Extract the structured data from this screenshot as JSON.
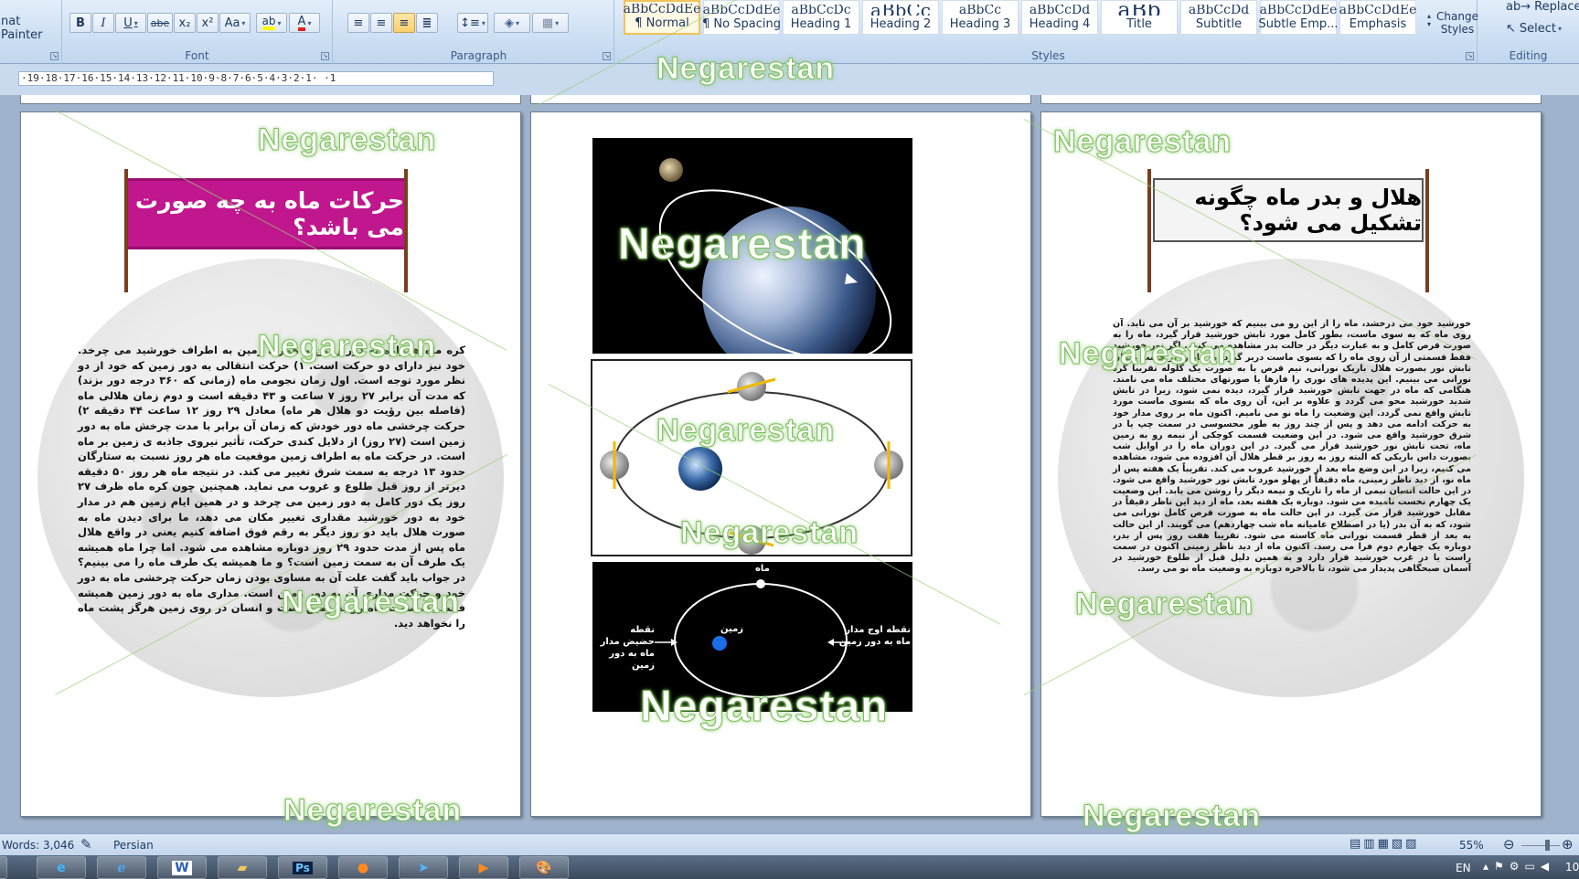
{
  "ribbon": {
    "clipboard": {
      "format_painter": "nat Painter"
    },
    "font": {
      "label": "Font",
      "buttons": [
        "B",
        "I",
        "U",
        "abe",
        "x₂",
        "x²",
        "Aa",
        "A"
      ]
    },
    "paragraph": {
      "label": "Paragraph"
    },
    "styles": {
      "label": "Styles",
      "items": [
        {
          "preview": "aBbCcDdEe",
          "name": "¶ Normal"
        },
        {
          "preview": "aBbCcDdEe",
          "name": "¶ No Spacing"
        },
        {
          "preview": "aBbCcDc",
          "name": "Heading 1"
        },
        {
          "preview": "aBbCc",
          "name": "Heading 2"
        },
        {
          "preview": "aBbCc",
          "name": "Heading 3"
        },
        {
          "preview": "aBbCcDd",
          "name": "Heading 4"
        },
        {
          "preview": "aBb",
          "name": "Title"
        },
        {
          "preview": "aBbCcDd",
          "name": "Subtitle"
        },
        {
          "preview": "aBbCcDdEe",
          "name": "Subtle Emp..."
        },
        {
          "preview": "aBbCcDdEe",
          "name": "Emphasis"
        }
      ],
      "change_styles": "Change Styles"
    },
    "editing": {
      "label": "Editing",
      "replace": "Replace",
      "select": "Select"
    }
  },
  "ruler": {
    "text": "·19·18·17·16·15·14·13·12·11·10·9·8·7·6·5·4·3·2·1· ·1"
  },
  "pages": {
    "left": {
      "banner_title": "حرکات ماه به چه صورت می باشد؟",
      "text": "کره ماه همواره به دور زمین و همراه زمین به اطراف خورشید می چرخد. خود نیز دارای دو حرکت است. ۱) حرکت انتقالی به دور زمین که خود از دو نظر مورد توجه است. اول زمان نجومی ماه (زمانی که ۳۶۰ درجه دور بزند) که مدت آن برابر ۲۷ روز ۷ ساعت و ۴۳ دقیقه است و دوم زمان هلالی ماه (فاصله بین رؤیت دو هلال هر ماه) معادل ۲۹ روز ۱۲ ساعت ۴۴ دقیقه ۲) حرکت چرخشی ماه دور خودش که زمان آن برابر با مدت چرخش ماه به دور زمین است (۲۷ روز) از دلایل کندی حرکت، تأثیر نیروی جاذبه ی زمین بر ماه است. در حرکت ماه به اطراف زمین موقعیت ماه هر روز نسبت به ستارگان حدود ۱۳ درجه به سمت شرق تغییر می کند. در نتیجه ماه هر روز ۵۰ دقیقه دیرتر از روز قبل طلوع و غروب می نماید. همچنین چون کره ماه ظرف ۲۷ روز یک دور کامل به دور زمین می چرخد و در همین ایام زمین هم در مدار خود به دور خورشید مقداری تغییر مکان می دهد، ما برای دیدن ماه به صورت هلال باید دو روز دیگر به رقم فوق اضافه کنیم یعنی در واقع هلال ماه پس از مدت حدود ۲۹ روز دوباره مشاهده می شود. اما چرا ماه همیشه یک طرف آن به سمت زمین است؟ و ما همیشه یک طرف ماه را می بینیم؟ در جواب باید گفت علت آن به مساوی بودن زمان حرکت چرخشی ماه به دور خود و حرکت مداری آن به دور زمین است. مداری ماه به دور زمین همیشه فقط یک سمت ماه رو به زمین است و انسان در روی زمین هرگز پشت ماه را نخواهد دید."
    },
    "middle": {
      "diagram3": {
        "moon_label": "ماه",
        "earth_label": "زمین",
        "perigee_label": "نقطه حضیض مدار ماه به دور زمین",
        "apogee_label": "نقطه اوج مدار ماه به دور زمین"
      }
    },
    "right": {
      "banner_title": "هلال و بدر ماه چگونه تشکیل می شود؟",
      "text": "خورشید خود می درخشد، ماه را از این رو می بینیم که خورشید بر آن می تابد. آن روی ماه که به سوی ماست، بطور کامل مورد تابش خورشید قرار گیرد، ماه را به صورت قرص کامل و به عبارت دیگر در حالت بدر مشاهده می کنیم. اگر نور خورشید فقط قسمتی از آن روی ماه را که بسوی ماست دربر گیرد، ما ماه را بر حسب میزان تابش نور بصورت هلال باریک نورانی، نیم قرص یا به صورت یک گلوله تقریبا گرد نورانی می بینیم. این پدیده های نوری را فازها یا صورتهای مختلف ماه می نامند. هنگامی که ماه در جهت تابش خورشید قرار گیرد، دیده نمی شود، زیرا در تابش شدید خورشید محو می گردد و علاوه بر این، آن روی ماه که بسوی ماست مورد تابش واقع نمی گردد. این وضعیت را ماه نو می نامیم. اکنون ماه بر روی مدار خود به حرکت ادامه می دهد و پس از چند روز به طور محسوسی در سمت چپ یا در شرق خورشید واقع می شود. در این وضعیت قسمت کوچکی از نیمه رو به زمین ماه، تحت تابش نور خورشید قرار می گیرد. در این دوران ماه را در اوایل شب بصورت داس باریکی که البته روز به روز بر قطر هلال آن افزوده می شود، مشاهده می کنیم، زیرا در این وضع ماه بعد از خورشید غروب می کند. تقریباً یک هفته پس از ماه نو، از دید ناظر زمینی، ماه دقیقاً از پهلو مورد تابش نور خورشید واقع می شود. در این حالت انسان نیمی از ماه را تاریک و نیمه دیگر را روشن می یابد. این وضعیت یک چهارم نخست نامیده می شود. دوباره یک هفته بعد، ماه از دید این ناظر دقیقاً در مقابل خورشید قرار می گیرد. در این حالت ماه به صورت قرص کامل نورانی می شود، که به آن بدر (یا در اصطلاح عامیانه ماه شب چهاردهم) می گویند. از این حالت به بعد از قطر قسمت نورانی ماه کاسته می شود. تقریبا هفت روز پس از بدر، دوباره یک چهارم دوم فرا می رسد. اکنون ماه از دید ناظر زمینی اکنون در سمت راست یا در غرب خورشید قرار دارد و به همین دلیل قبل از طلوع خورشید در آسمان صبحگاهی پدیدار می شود، تا بالاخره دوباره به وضعیت ماه نو می رسد."
    }
  },
  "watermark": "Negarestan",
  "status": {
    "words": "Words: 3,046",
    "language": "Persian",
    "zoom": "55%"
  },
  "taskbar": {
    "lang": "EN",
    "clock": "10"
  }
}
